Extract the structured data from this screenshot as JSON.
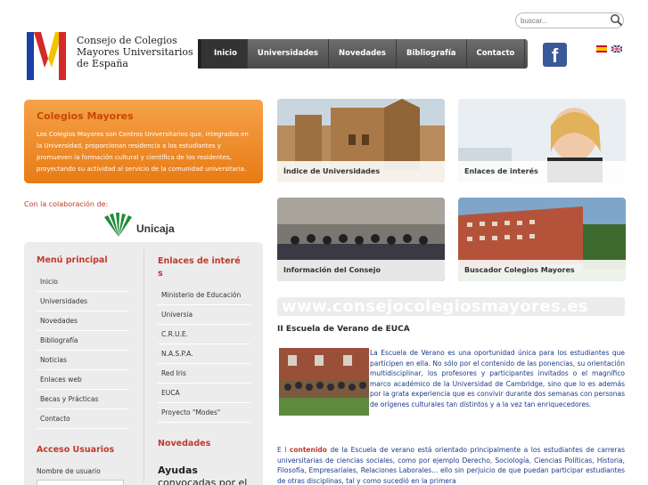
{
  "header": {
    "logo_line1": "Consejo de Colegios",
    "logo_line2": "Mayores Universitarios",
    "logo_line3": "de España",
    "search_placeholder": "buscar...",
    "facebook_glyph": "f"
  },
  "nav": {
    "items": [
      "Inicio",
      "Universidades",
      "Novedades",
      "Bibliografía",
      "Contacto"
    ],
    "active": "Inicio"
  },
  "hero": {
    "title": "Colegios Mayores",
    "text": "Los Colegios Mayores son Centros Universitarios que, integrados en la Universidad, proporcionan residencia a los estudiantes y promueven la formación cultural y científica de los residentes, proyectando su actividad al servicio de la comunidad universitaria."
  },
  "colab": {
    "label": "Con la colaboración de:",
    "sponsor": "Unicaja"
  },
  "menu_principal": {
    "title": "Menú principal",
    "items": [
      "Inicio",
      "Universidades",
      "Novedades",
      "Bibliografía",
      "Noticias",
      "Enlaces web",
      "Becas y Prácticas",
      "Contacto"
    ]
  },
  "enlaces": {
    "title_line1": "Enlaces de interé",
    "title_line2": "s",
    "items": [
      "Ministerio de Educación",
      "Universia",
      "C.R.U.E.",
      "N.A.S.P.A.",
      "Red Iris",
      "EUCA",
      "Proyecto \"Modes\""
    ]
  },
  "acceso": {
    "title": "Acceso Usuarios",
    "username_label": "Nombre de usuario"
  },
  "novedades": {
    "title": "Novedades",
    "item_line1": "Ayudas",
    "item_line2": "convocadas por el"
  },
  "tiles": [
    {
      "caption": "Índice de Universidades"
    },
    {
      "caption": "Enlaces de interés"
    },
    {
      "caption": "Información del Consejo"
    },
    {
      "caption": "Buscador Colegios Mayores"
    }
  ],
  "domain_banner": "www.consejocolegiosmayores.es",
  "article": {
    "title": "II Escuela de Verano de EUCA",
    "p1": "La Escuela de Verano es una oportunidad única para los estudiantes que participen en ella. No sólo por el contenido de las ponencias, su orientación multidisciplinar, los profesores y participantes invitados o el magnífico marco académico de la Universidad de Cambridge, sino que lo es además por la grata experiencia que es convivir durante dos semanas con personas de orígenes culturales tan distintos y a la vez tan enriquecedores.",
    "p2_prefix": "E l ",
    "p2_bold": "contenido",
    "p2_rest": " de la Escuela de verano está orientado principalmente a los estudiantes de carreras universitarias de ciencias sociales, como por ejemplo Derecho, Sociología, Ciencias Políticas, Historia, Filosofía, Empresariales, Relaciones Laborales... ello sin perjuicio de que puedan participar estudiantes de otras disciplinas, tal y como sucedió en la primera"
  },
  "colors": {
    "accent_red": "#c0392b",
    "hero_orange": "#e87b14",
    "nav_dark": "#4a4a4a",
    "body_link_blue": "#1a3a8a"
  }
}
